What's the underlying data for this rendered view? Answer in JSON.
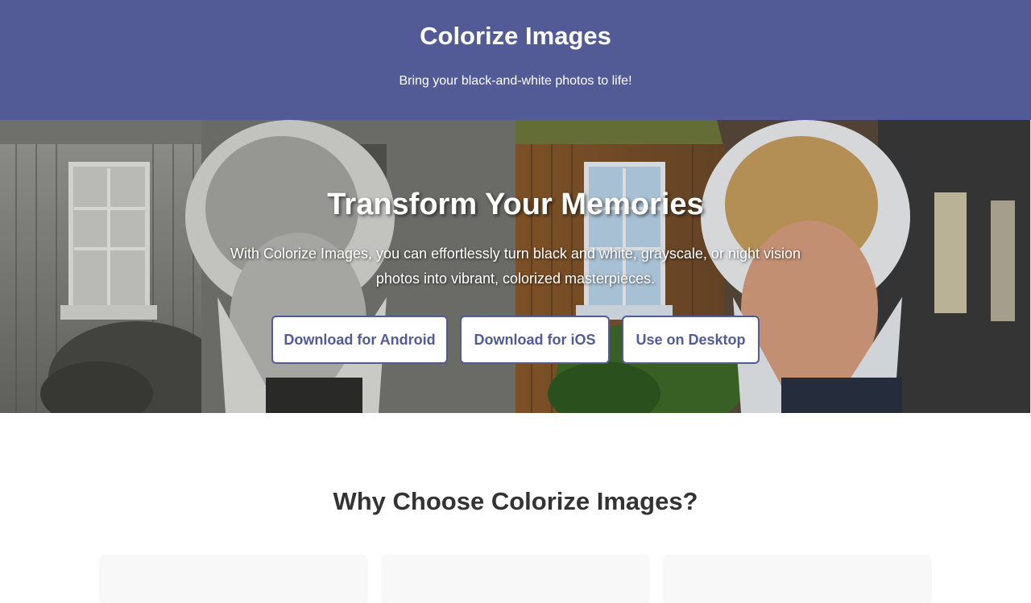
{
  "header": {
    "title": "Colorize Images",
    "tagline": "Bring your black-and-white photos to life!"
  },
  "hero": {
    "heading": "Transform Your Memories",
    "description": "With Colorize Images, you can effortlessly turn black and white, grayscale, or night vision photos into vibrant, colorized masterpieces.",
    "buttons": {
      "android": "Download for Android",
      "ios": "Download for iOS",
      "desktop": "Use on Desktop"
    }
  },
  "features": {
    "heading": "Why Choose Colorize Images?"
  },
  "colors": {
    "brand": "#525b96",
    "background": "#ffffff",
    "text": "#333333"
  }
}
